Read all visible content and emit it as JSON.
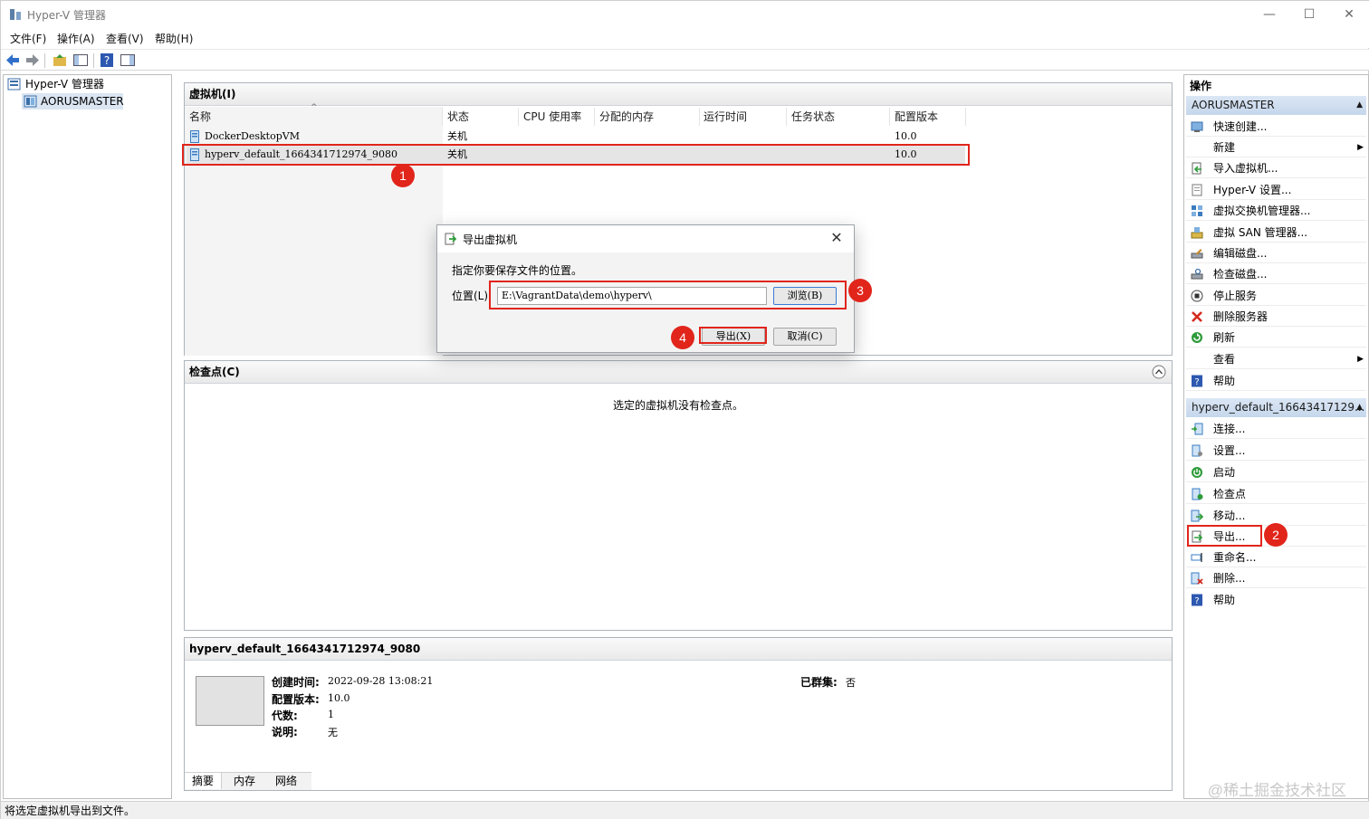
{
  "window": {
    "title": "Hyper-V 管理器"
  },
  "menu": [
    "文件(F)",
    "操作(A)",
    "查看(V)",
    "帮助(H)"
  ],
  "tree": {
    "root": "Hyper-V 管理器",
    "server": "AORUSMASTER"
  },
  "vms_panel": {
    "title": "虚拟机(I)",
    "columns": [
      "名称",
      "状态",
      "CPU 使用率",
      "分配的内存",
      "运行时间",
      "任务状态",
      "配置版本"
    ],
    "rows": [
      {
        "name": "DockerDesktopVM",
        "state": "关机",
        "version": "10.0"
      },
      {
        "name": "hyperv_default_1664341712974_9080",
        "state": "关机",
        "version": "10.0"
      }
    ]
  },
  "checkpoints_panel": {
    "title": "检查点(C)",
    "empty_message": "选定的虚拟机没有检查点。"
  },
  "details_panel": {
    "title": "hyperv_default_1664341712974_9080",
    "created_label": "创建时间:",
    "created_value": "2022-09-28 13:08:21",
    "config_label": "配置版本:",
    "config_value": "10.0",
    "generation_label": "代数:",
    "generation_value": "1",
    "notes_label": "说明:",
    "notes_value": "无",
    "clustered_label": "已群集:",
    "clustered_value": "否",
    "tabs": [
      "摘要",
      "内存",
      "网络"
    ]
  },
  "dialog": {
    "title": "导出虚拟机",
    "prompt": "指定你要保存文件的位置。",
    "location_label": "位置(L):",
    "location_value": "E:\\VagrantData\\demo\\hyperv\\",
    "browse_label": "浏览(B)",
    "export_label": "导出(X)",
    "cancel_label": "取消(C)"
  },
  "actions_pane": {
    "title": "操作",
    "server_header": "AORUSMASTER",
    "server_items": [
      {
        "label": "快速创建...",
        "icon": "quick-create-icon"
      },
      {
        "label": "新建",
        "icon": "",
        "submenu": true
      },
      {
        "label": "导入虚拟机...",
        "icon": "import-icon"
      },
      {
        "label": "Hyper-V 设置...",
        "icon": "settings-doc-icon"
      },
      {
        "label": "虚拟交换机管理器...",
        "icon": "switch-icon"
      },
      {
        "label": "虚拟 SAN 管理器...",
        "icon": "san-icon"
      },
      {
        "label": "编辑磁盘...",
        "icon": "edit-disk-icon"
      },
      {
        "label": "检查磁盘...",
        "icon": "inspect-disk-icon"
      },
      {
        "label": "停止服务",
        "icon": "stop-icon"
      },
      {
        "label": "删除服务器",
        "icon": "delete-x-icon"
      },
      {
        "label": "刷新",
        "icon": "refresh-icon"
      },
      {
        "label": "查看",
        "icon": "",
        "submenu": true
      },
      {
        "label": "帮助",
        "icon": "help-icon"
      }
    ],
    "vm_header": "hyperv_default_16643417129...",
    "vm_items": [
      {
        "label": "连接...",
        "icon": "connect-icon"
      },
      {
        "label": "设置...",
        "icon": "vm-settings-icon"
      },
      {
        "label": "启动",
        "icon": "power-icon"
      },
      {
        "label": "检查点",
        "icon": "checkpoint-icon"
      },
      {
        "label": "移动...",
        "icon": "move-icon"
      },
      {
        "label": "导出...",
        "icon": "export-icon"
      },
      {
        "label": "重命名...",
        "icon": "rename-icon"
      },
      {
        "label": "删除...",
        "icon": "delete-vm-icon"
      },
      {
        "label": "帮助",
        "icon": "help-icon"
      }
    ]
  },
  "annotations": [
    "1",
    "2",
    "3",
    "4"
  ],
  "status_text": "将选定虚拟机导出到文件。",
  "watermark": "@稀土掘金技术社区",
  "colors": {
    "highlight_red": "#e1251b",
    "action_header": "#c6d7ec"
  }
}
